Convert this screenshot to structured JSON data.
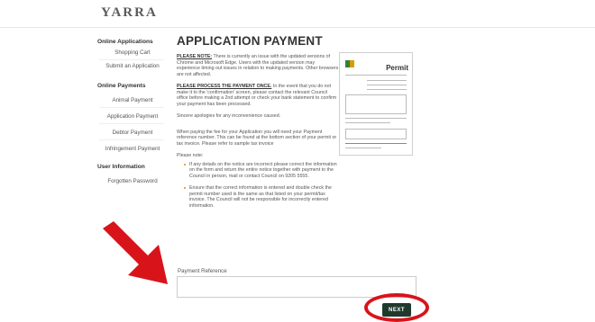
{
  "logo": "YARRA",
  "sidebar": {
    "sections": [
      {
        "heading": "Online Applications",
        "items": [
          "Shopping Cart",
          "Submit an Application"
        ]
      },
      {
        "heading": "Online Payments",
        "items": [
          "Animal Payment",
          "Application Payment",
          "Debtor Payment",
          "Infringement Payment"
        ]
      },
      {
        "heading": "User Information",
        "items": [
          "Forgotten Password"
        ]
      }
    ]
  },
  "main": {
    "title": "APPLICATION PAYMENT",
    "note1_label": "PLEASE NOTE:",
    "note1_text": " There is currently an issue with the updated versions of Chrome and Microsoft Edge. Users with the updated version may experience timing out issues in relation to making payments. Other browsers are not affected.",
    "note2_label": "PLEASE PROCESS THE PAYMENT ONCE.",
    "note2_text": " In the event that you do not make it to the 'confirmation' screen, please contact the relevant Council office before making a 2nd attempt or check your bank statement to confirm your payment has been processed.",
    "apology": "Sincere apologies for any inconvenience caused.",
    "instructions": "When paying the fee for your Application you will need your Payment reference number. This can be found at the bottom section of your permit or tax invoice. Please refer to sample tax invoice",
    "please_note": "Please note:",
    "bullets": [
      "If any details on the notice are incorrect please correct the information on the form and return the entire notice together with payment to the Council in person, mail or contact Council on 9205 5555.",
      "Ensure that the correct information is entered and double check the permit number used is the same as that listed on your permit/tax invoice. The Council will not be responsible for incorrectly entered information."
    ]
  },
  "sample": {
    "title": "Permit"
  },
  "payment_reference": {
    "label": "Payment Reference",
    "value": ""
  },
  "next_button": "NEXT",
  "colors": {
    "next_bg": "#1f3a2c",
    "annotation_red": "#d8141a",
    "bullet": "#e08b00"
  }
}
